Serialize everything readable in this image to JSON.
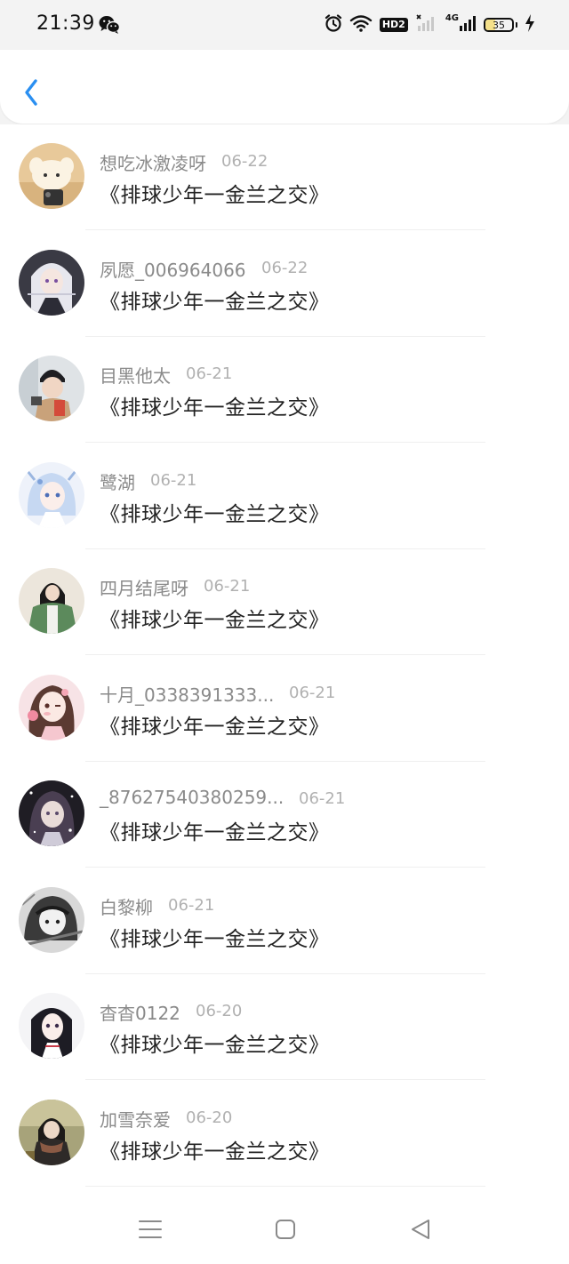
{
  "status_bar": {
    "time": "21:39",
    "battery_level": "35",
    "battery_fraction": 0.35,
    "network_label": "4G",
    "hd_label": "HD2",
    "icons": [
      "wechat-icon",
      "alarm-icon",
      "wifi-icon",
      "hd-icon",
      "signal-icon",
      "battery-icon",
      "charging-icon"
    ]
  },
  "header": {
    "back_icon": "chevron-left-icon",
    "accent_color": "#2a8ff1"
  },
  "list": {
    "items": [
      {
        "username": "想吃冰激凌呀",
        "date": "06-22",
        "text": "《排球少年一金兰之交》"
      },
      {
        "username": "夙愿_006964066",
        "date": "06-22",
        "text": "《排球少年一金兰之交》"
      },
      {
        "username": "目黑他太",
        "date": "06-21",
        "text": "《排球少年一金兰之交》"
      },
      {
        "username": "鹭湖",
        "date": "06-21",
        "text": "《排球少年一金兰之交》"
      },
      {
        "username": "四月结尾呀",
        "date": "06-21",
        "text": "《排球少年一金兰之交》"
      },
      {
        "username": "十月_0338391333...",
        "date": "06-21",
        "text": "《排球少年一金兰之交》"
      },
      {
        "username": "_87627540380259...",
        "date": "06-21",
        "text": "《排球少年一金兰之交》"
      },
      {
        "username": "白黎柳",
        "date": "06-21",
        "text": "《排球少年一金兰之交》"
      },
      {
        "username": "杳杳0122",
        "date": "06-20",
        "text": "《排球少年一金兰之交》"
      },
      {
        "username": "加雪奈爱",
        "date": "06-20",
        "text": "《排球少年一金兰之交》"
      }
    ]
  },
  "bottom_nav": {
    "icons": [
      "menu-icon",
      "home-square-icon",
      "back-triangle-icon"
    ]
  }
}
